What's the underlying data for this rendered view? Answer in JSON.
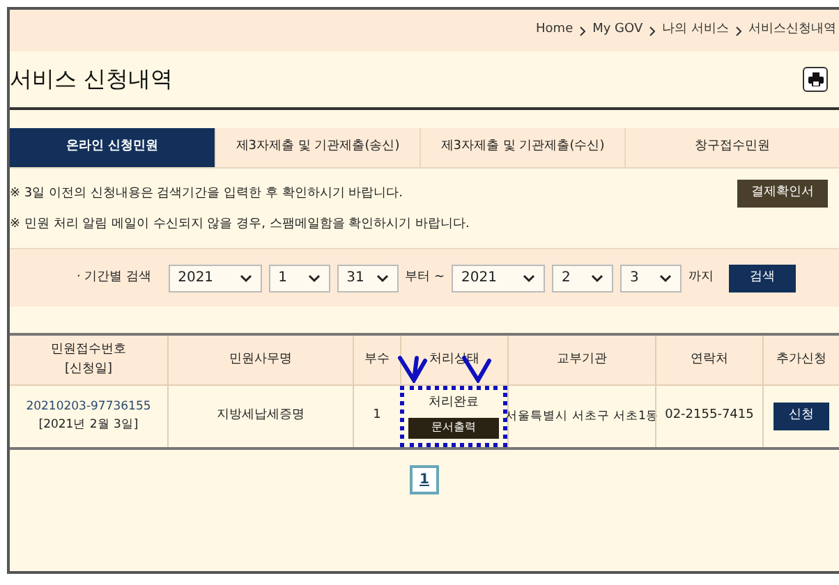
{
  "breadcrumb": [
    "Home",
    "My GOV",
    "나의 서비스",
    "서비스신청내역"
  ],
  "title": "서비스 신청내역",
  "tabs": [
    {
      "label": "온라인 신청민원",
      "selected": true
    },
    {
      "label": "제3자제출 및 기관제출(송신)",
      "selected": false
    },
    {
      "label": "제3자제출 및 기관제출(수신)",
      "selected": false
    },
    {
      "label": "창구접수민원",
      "selected": false
    }
  ],
  "notices": [
    "※ 3일 이전의 신청내용은 검색기간을 입력한 후 확인하시기 바랍니다.",
    "※ 민원 처리 알림 메일이 수신되지 않을 경우, 스팸메일함을 확인하시기 바랍니다."
  ],
  "payment_button": "결제확인서",
  "search": {
    "label": "· 기간별 검색",
    "from": [
      "2021",
      "1",
      "31"
    ],
    "from_suffix": "부터 ~",
    "to": [
      "2021",
      "2",
      "3"
    ],
    "to_suffix": "까지",
    "button": "검색"
  },
  "table": {
    "columns": [
      [
        "민원접수번호",
        "[신청일]"
      ],
      [
        "민원사무명"
      ],
      [
        "부수"
      ],
      [
        "처리상태"
      ],
      [
        "교부기관"
      ],
      [
        "연락처"
      ],
      [
        "추가신청"
      ]
    ],
    "rows": [
      {
        "number": "20210203-97736155",
        "date": "[2021년 2월 3일]",
        "name": "지방세납세증명",
        "copies": "1",
        "status": "처리완료",
        "print_button": "문서출력",
        "office": "서울특별시 서초구 서초1동",
        "phone": "02-2155-7415",
        "apply_button": "신청",
        "highlighted": true
      }
    ]
  },
  "pagination": [
    {
      "label": "1",
      "selected": true
    }
  ]
}
